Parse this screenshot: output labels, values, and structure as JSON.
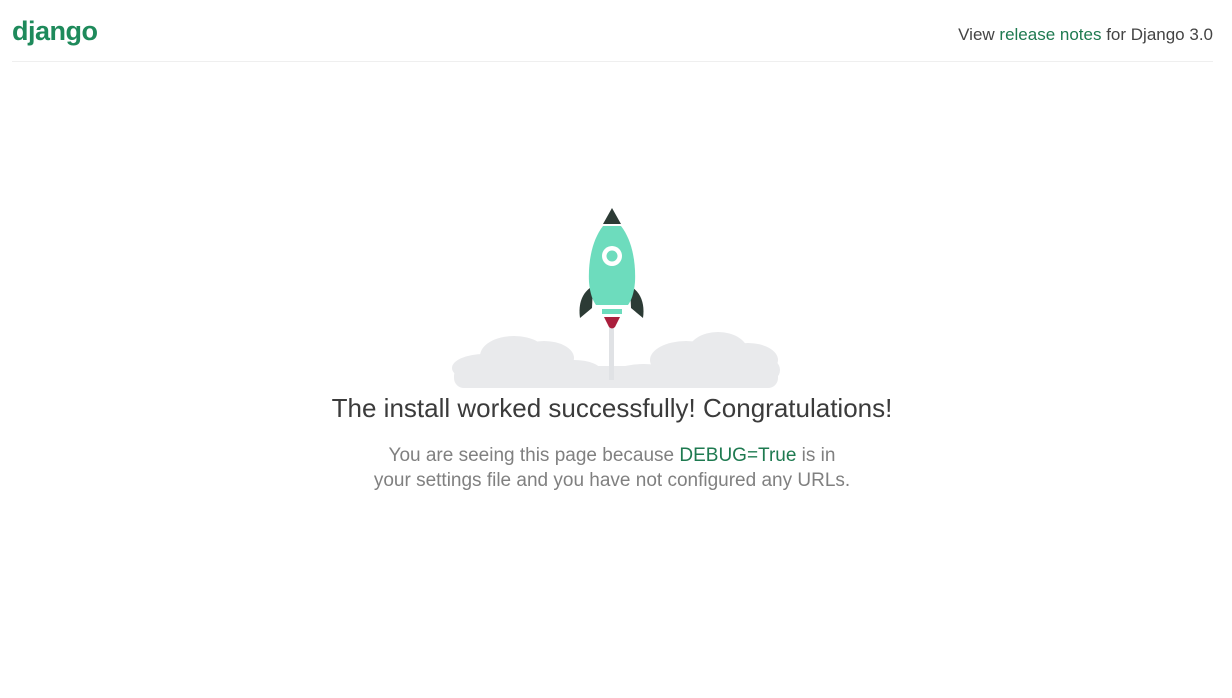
{
  "header": {
    "logo": "django",
    "release_prefix": "View ",
    "release_link": "release notes",
    "release_suffix": " for Django 3.0"
  },
  "main": {
    "title": "The install worked successfully! Congratulations!",
    "desc_prefix": "You are seeing this page because ",
    "desc_debug": "DEBUG=True",
    "desc_suffix": " is in your settings file and you have not configured any URLs."
  },
  "colors": {
    "brand": "#1e8a5b",
    "link": "#1e7a50",
    "rocket_body": "#6ddcbd",
    "rocket_dark": "#2c3b35",
    "flame": "#aa1e3c",
    "cloud": "#e9eaec"
  }
}
